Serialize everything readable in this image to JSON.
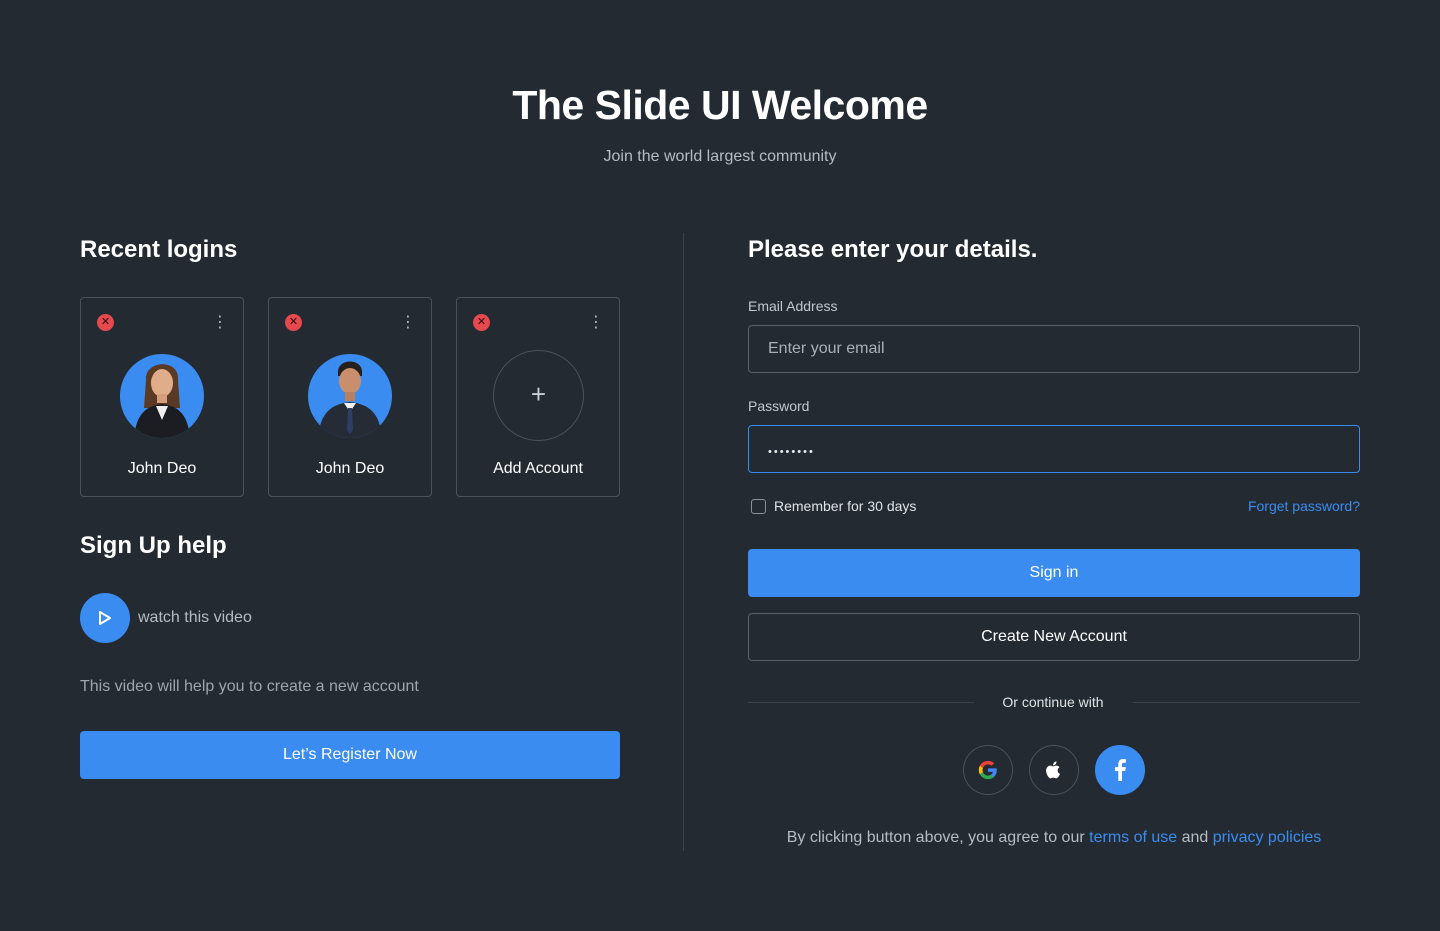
{
  "header": {
    "title": "The Slide UI Welcome",
    "subtitle": "Join the world largest community"
  },
  "recent_logins": {
    "title": "Recent logins",
    "accounts": [
      {
        "name": "John Deo",
        "avatar_icon": "avatar-woman"
      },
      {
        "name": "John Deo",
        "avatar_icon": "avatar-man"
      }
    ],
    "add_account_label": "Add Account",
    "remove_icon": "close-circle-icon",
    "menu_icon": "more-vertical-icon"
  },
  "signup_help": {
    "title": "Sign Up help",
    "video_label": "watch this video",
    "description": "This video will help you to create a new account",
    "register_button": "Let’s Register Now"
  },
  "login_form": {
    "title": "Please enter your details.",
    "email_label": "Email Address",
    "email_placeholder": "Enter your email",
    "password_label": "Password",
    "password_masked": "••••••••",
    "remember_label": "Remember for 30 days",
    "remember_checked": false,
    "forgot_link": "Forget password?",
    "sign_in_button": "Sign in",
    "create_account_button": "Create New Account",
    "continue_with": "Or continue with",
    "social_providers": [
      "google",
      "apple",
      "facebook"
    ],
    "terms_prefix": "By clicking button above, you agree to our",
    "terms_link": "terms of use",
    "terms_and": "and",
    "privacy_link": "privacy policies"
  },
  "colors": {
    "background": "#232a32",
    "accent": "#3b8cf0",
    "danger": "#e5484d"
  }
}
